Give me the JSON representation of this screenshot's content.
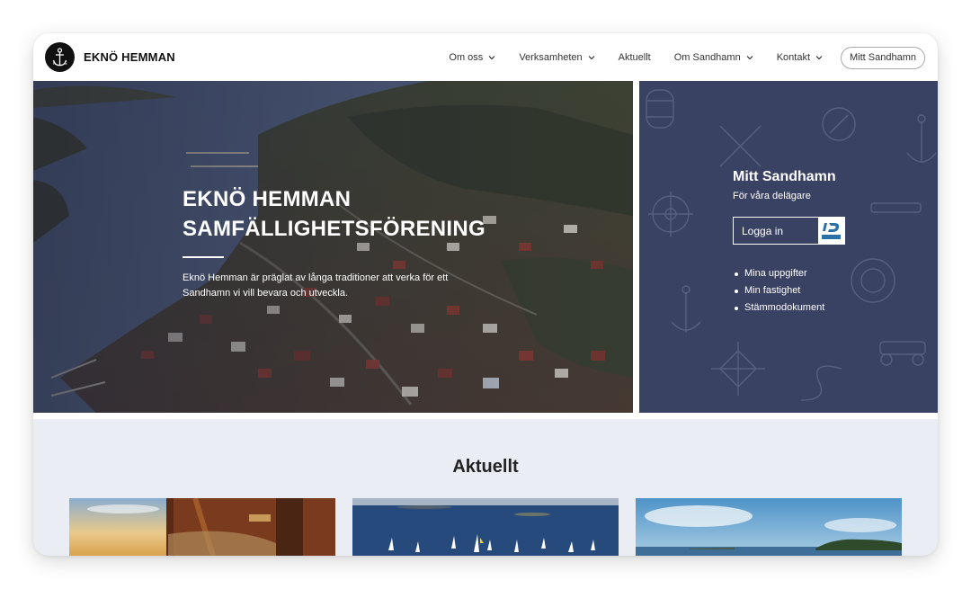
{
  "header": {
    "brand": "EKNÖ HEMMAN",
    "nav": [
      {
        "label": "Om oss",
        "dropdown": true
      },
      {
        "label": "Verksamheten",
        "dropdown": true
      },
      {
        "label": "Aktuellt",
        "dropdown": false
      },
      {
        "label": "Om Sandhamn",
        "dropdown": true
      },
      {
        "label": "Kontakt",
        "dropdown": true
      }
    ],
    "cta": "Mitt Sandhamn"
  },
  "hero": {
    "title_line1": "EKNÖ HEMMAN",
    "title_line2": "SAMFÄLLIGHETSFÖRENING",
    "text": "Eknö Hemman är präglat av långa traditioner att verka för ett Sandhamn vi vill bevara och utveckla."
  },
  "panel": {
    "title": "Mitt Sandhamn",
    "subtitle": "För våra delägare",
    "login_label": "Logga in",
    "links": [
      "Mina uppgifter",
      "Min fastighet",
      "Stämmodokument"
    ]
  },
  "news": {
    "title": "Aktuellt"
  },
  "colors": {
    "panel_bg": "#3a4263",
    "news_bg": "#ebedf5",
    "bankid_blue": "#2b6fa8"
  },
  "icons": [
    "anchor-logo-icon",
    "chevron-down-icon",
    "bankid-icon"
  ]
}
